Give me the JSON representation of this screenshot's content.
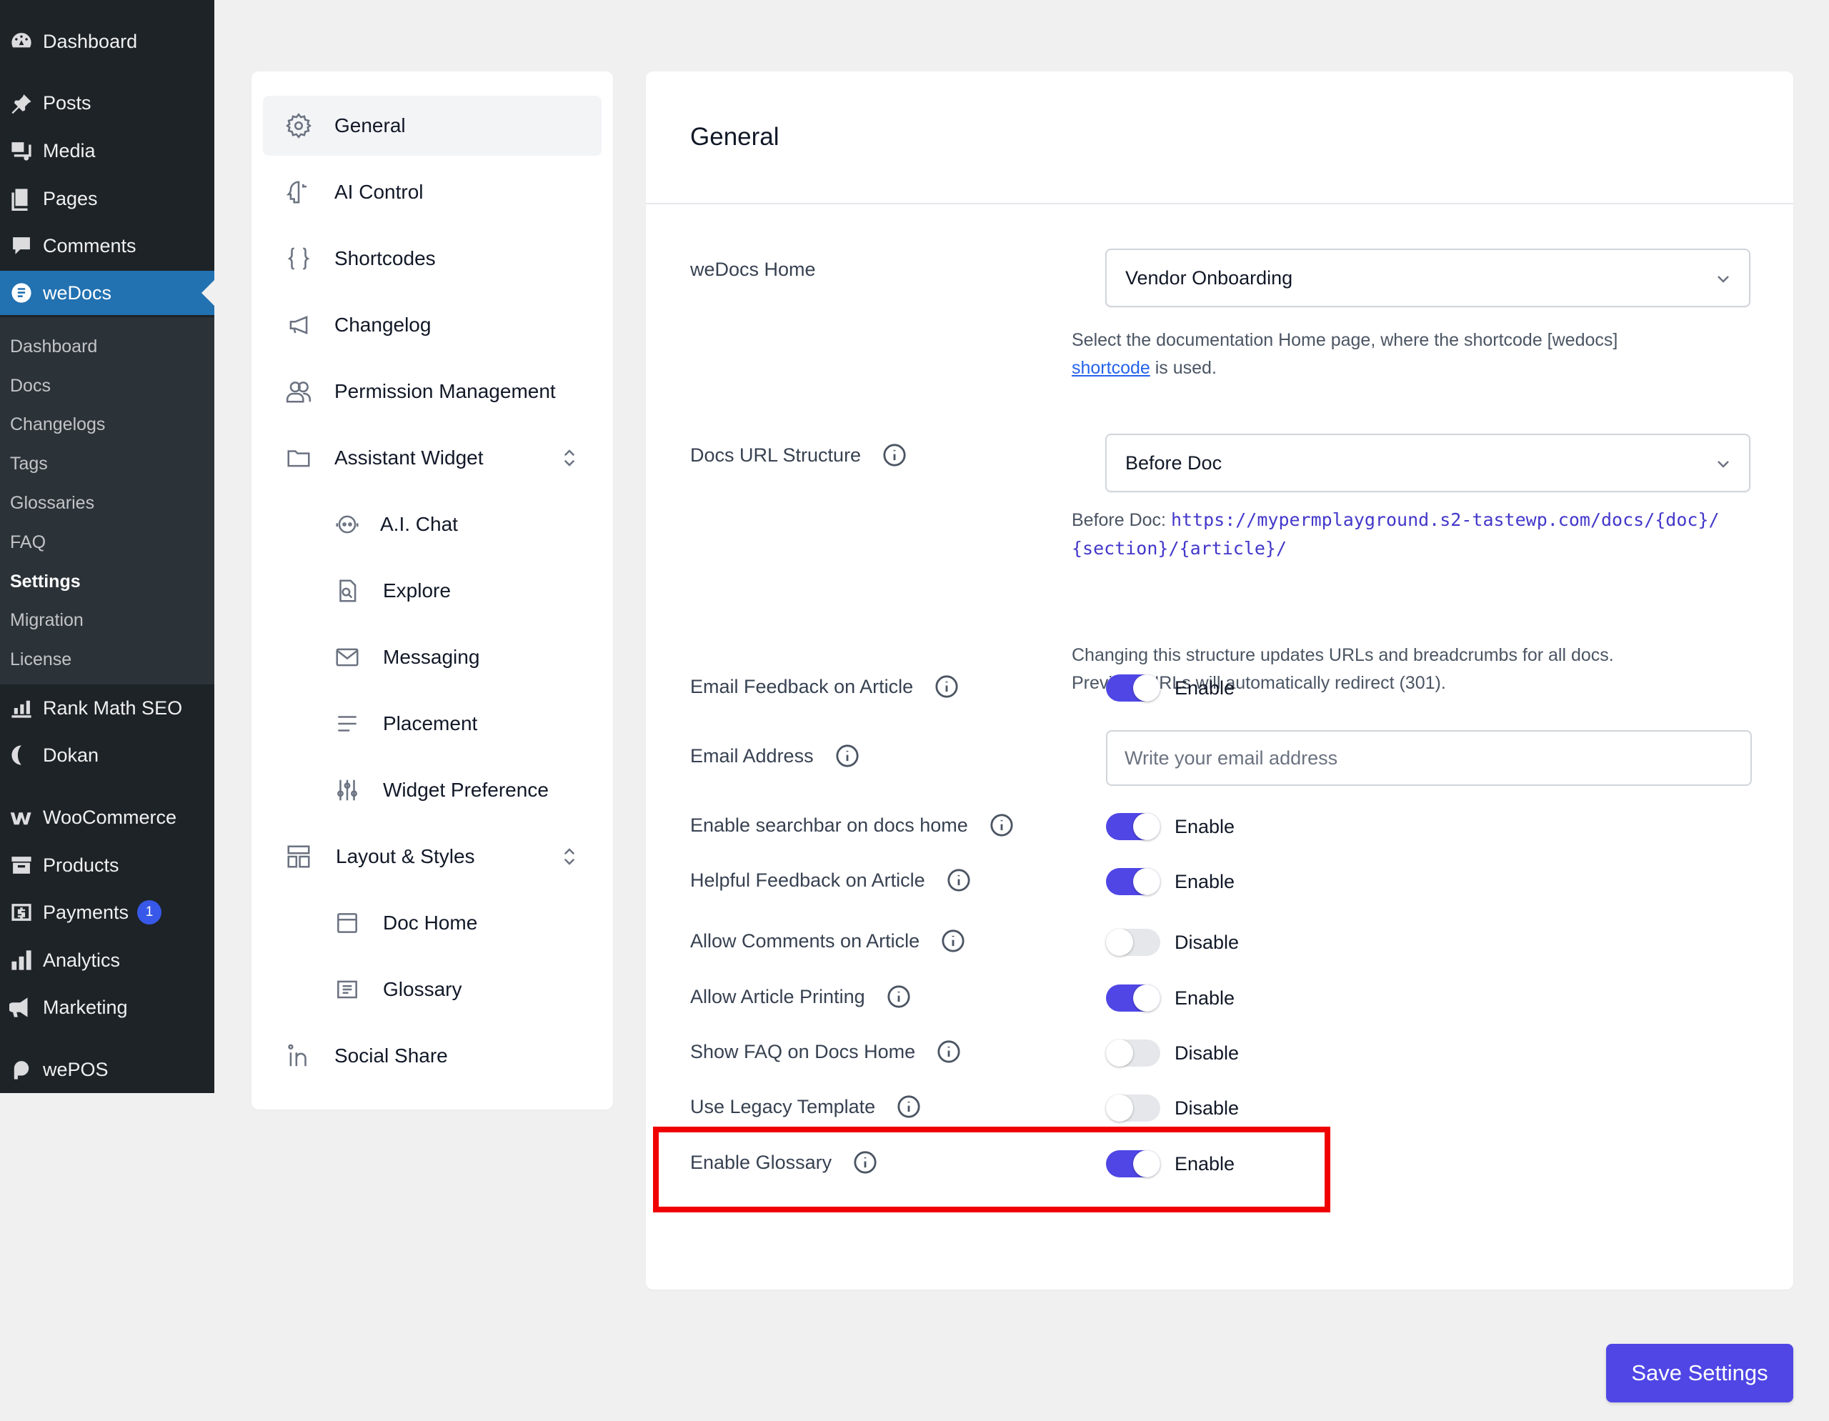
{
  "wp_menu": {
    "dashboard": "Dashboard",
    "posts": "Posts",
    "media": "Media",
    "pages": "Pages",
    "comments": "Comments",
    "wedocs": "weDocs",
    "submenu": [
      "Dashboard",
      "Docs",
      "Changelogs",
      "Tags",
      "Glossaries",
      "FAQ",
      "Settings",
      "Migration",
      "License"
    ],
    "rankmath": "Rank Math SEO",
    "dokan": "Dokan",
    "woocommerce": "WooCommerce",
    "products": "Products",
    "payments": "Payments",
    "payments_badge": "1",
    "analytics": "Analytics",
    "marketing": "Marketing",
    "wepos": "wePOS"
  },
  "settings_nav": {
    "general": "General",
    "ai_control": "AI Control",
    "shortcodes": "Shortcodes",
    "changelog": "Changelog",
    "permission": "Permission Management",
    "assistant_widget": "Assistant Widget",
    "ai_chat": "A.I. Chat",
    "explore": "Explore",
    "messaging": "Messaging",
    "placement": "Placement",
    "widget_preference": "Widget Preference",
    "layout_styles": "Layout & Styles",
    "doc_home": "Doc Home",
    "glossary": "Glossary",
    "social_share": "Social Share"
  },
  "panel": {
    "title": "General",
    "wedocs_home": {
      "label": "weDocs Home",
      "value": "Vendor Onboarding",
      "help_before": "Select the documentation Home page, where the shortcode [wedocs]",
      "help_link": "shortcode",
      "help_after": " is used."
    },
    "url_structure": {
      "label": "Docs URL Structure",
      "value": "Before Doc",
      "prefix": "Before Doc: ",
      "url_line1": "https://mypermplayground.s2-tastewp.com/docs/{doc}/",
      "url_line2": "{section}/{article}/",
      "note_line1": "Changing this structure updates URLs and breadcrumbs for all docs.",
      "note_line2": "Previous URLs will automatically redirect (301)."
    },
    "email_feedback": {
      "label": "Email Feedback on Article",
      "state": "Enable"
    },
    "email_address": {
      "label": "Email Address",
      "placeholder": "Write your email address"
    },
    "searchbar": {
      "label": "Enable searchbar on docs home",
      "state": "Enable"
    },
    "helpful_feedback": {
      "label": "Helpful Feedback on Article",
      "state": "Enable"
    },
    "allow_comments": {
      "label": "Allow Comments on Article",
      "state": "Disable"
    },
    "allow_printing": {
      "label": "Allow Article Printing",
      "state": "Enable"
    },
    "show_faq": {
      "label": "Show FAQ on Docs Home",
      "state": "Disable"
    },
    "legacy_template": {
      "label": "Use Legacy Template",
      "state": "Disable"
    },
    "enable_glossary": {
      "label": "Enable Glossary",
      "state": "Enable"
    }
  },
  "save_button": "Save Settings",
  "colors": {
    "accent": "#4f46e5",
    "wp_active": "#2271b1",
    "highlight": "#f00000"
  }
}
